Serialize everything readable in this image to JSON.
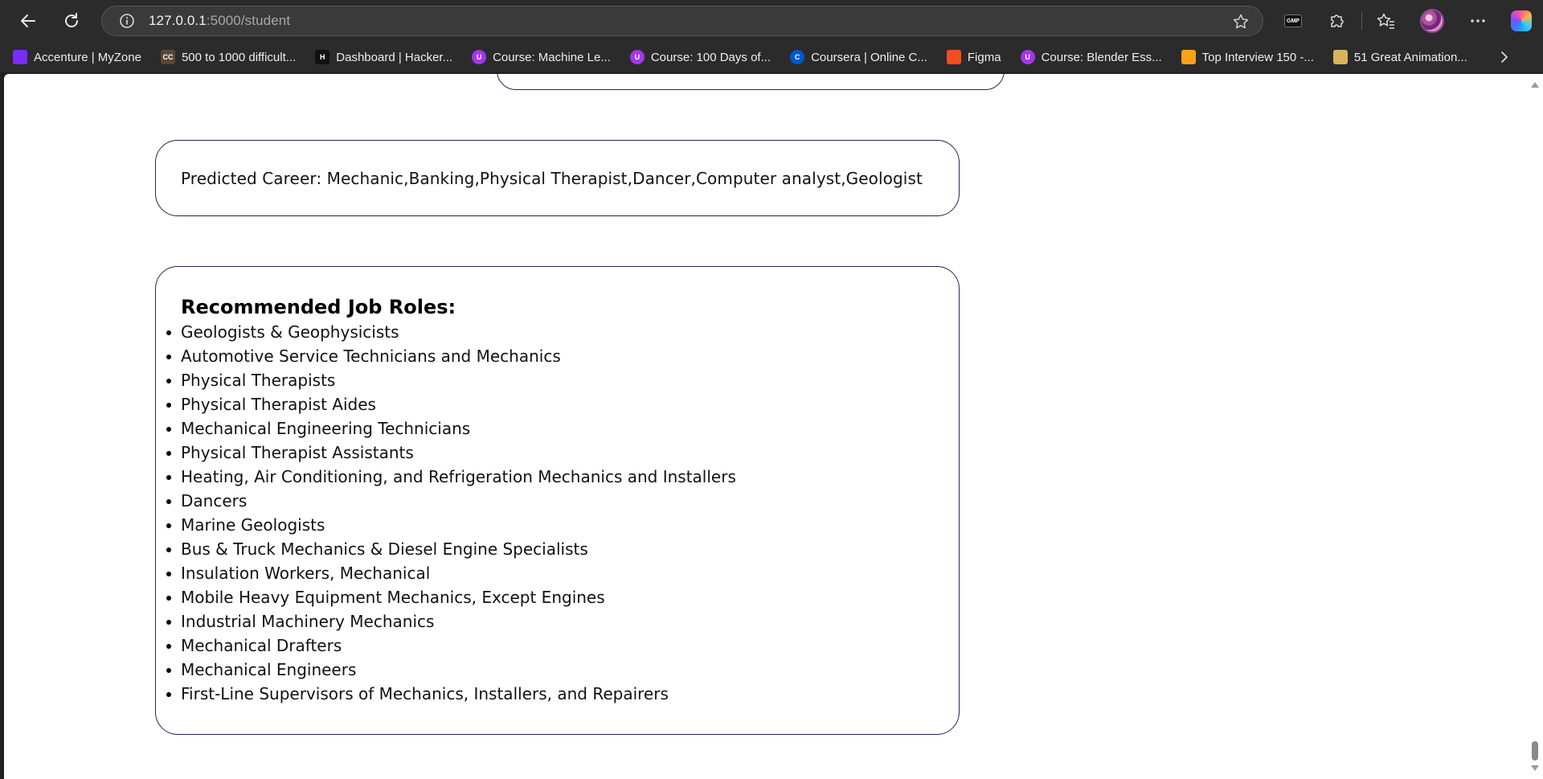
{
  "browser": {
    "url_host": "127.0.0.1",
    "url_port_path": ":5000/student",
    "extension_badge": "GMP",
    "bookmarks": [
      {
        "label": "Accenture | MyZone",
        "icon": "accenture-icon",
        "icon_text": "",
        "color": "#7b2bf9"
      },
      {
        "label": "500 to 1000 difficult...",
        "icon": "codechef-icon",
        "icon_text": "CC",
        "color": "#5b4638"
      },
      {
        "label": "Dashboard | Hacker...",
        "icon": "hackerrank-icon",
        "icon_text": "H",
        "color": "#111111"
      },
      {
        "label": "Course: Machine Le...",
        "icon": "udemy-icon",
        "icon_text": "U",
        "color": "#a435f0"
      },
      {
        "label": "Course: 100 Days of...",
        "icon": "udemy-icon",
        "icon_text": "U",
        "color": "#a435f0"
      },
      {
        "label": "Coursera | Online C...",
        "icon": "coursera-icon",
        "icon_text": "C",
        "color": "#0056d2"
      },
      {
        "label": "Figma",
        "icon": "figma-icon",
        "icon_text": "",
        "color": "#f24e1e"
      },
      {
        "label": "Course: Blender Ess...",
        "icon": "udemy-icon",
        "icon_text": "U",
        "color": "#a435f0"
      },
      {
        "label": "Top Interview 150 -...",
        "icon": "leetcode-icon",
        "icon_text": "",
        "color": "#ffa116"
      },
      {
        "label": "51 Great Animation...",
        "icon": "island-icon",
        "icon_text": "",
        "color": "#d9b45a"
      }
    ]
  },
  "page": {
    "predicted_career": "Predicted Career: Mechanic,Banking,Physical Therapist,Dancer,Computer analyst,Geologist",
    "recommended_title": "Recommended Job Roles:",
    "job_roles": [
      "Geologists & Geophysicists",
      "Automotive Service Technicians and Mechanics",
      "Physical Therapists",
      "Physical Therapist Aides",
      "Mechanical Engineering Technicians",
      "Physical Therapist Assistants",
      "Heating, Air Conditioning, and Refrigeration Mechanics and Installers",
      "Dancers",
      "Marine Geologists",
      "Bus & Truck Mechanics & Diesel Engine Specialists",
      "Insulation Workers, Mechanical",
      "Mobile Heavy Equipment Mechanics, Except Engines",
      "Industrial Machinery Mechanics",
      "Mechanical Drafters",
      "Mechanical Engineers",
      "First-Line Supervisors of Mechanics, Installers, and Repairers"
    ]
  },
  "colors": {
    "card_border": "#1f2a55",
    "chrome_bg": "#2b2b2b"
  }
}
